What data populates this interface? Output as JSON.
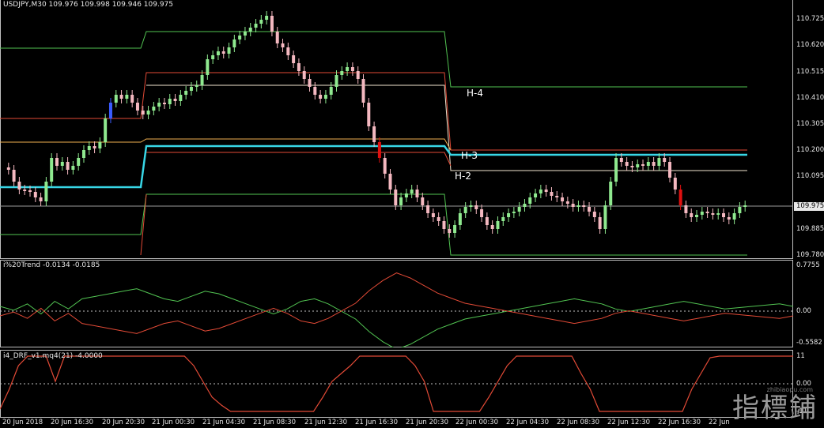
{
  "main": {
    "header": "USDJPY,M30  109.976 109.998 109.946 109.975",
    "current_price": "109.975",
    "ticks": [
      "110.725",
      "110.620",
      "110.515",
      "110.410",
      "110.305",
      "110.200",
      "110.095",
      "109.885",
      "109.780"
    ],
    "level_labels": [
      "H-4",
      "H-3",
      "H-2"
    ]
  },
  "sub1": {
    "header": "i%20Trend -0.0134 -0.0185",
    "ticks": [
      "0.7755",
      "0.00",
      "-0.5582"
    ]
  },
  "sub2": {
    "header": "i4_DRF_v1.mq4(21) -4.0000",
    "ticks": [
      "11",
      "0.00",
      "-11"
    ]
  },
  "time_axis": [
    "20 Jun 2018",
    "20 Jun 16:30",
    "20 Jun 20:30",
    "21 Jun 00:30",
    "21 Jun 04:30",
    "21 Jun 08:30",
    "21 Jun 12:30",
    "21 Jun 16:30",
    "21 Jun 20:30",
    "22 Jun 00:30",
    "22 Jun 04:30",
    "22 Jun 08:30",
    "22 Jun 12:30",
    "22 Jun 16:30",
    "22 Jun"
  ],
  "watermark": "指標鋪",
  "watermark_url": "zhibiaopu.com",
  "colors": {
    "bull": "#8fe98f",
    "bear": "#f4b8c0",
    "bull_big": "#3a5cff",
    "bear_big": "#e01010",
    "cyan": "#38d6e6",
    "green_line": "#52c452",
    "red_line": "#e24a36",
    "orange_line": "#f0b050",
    "light_line": "#f2e6d0"
  }
}
